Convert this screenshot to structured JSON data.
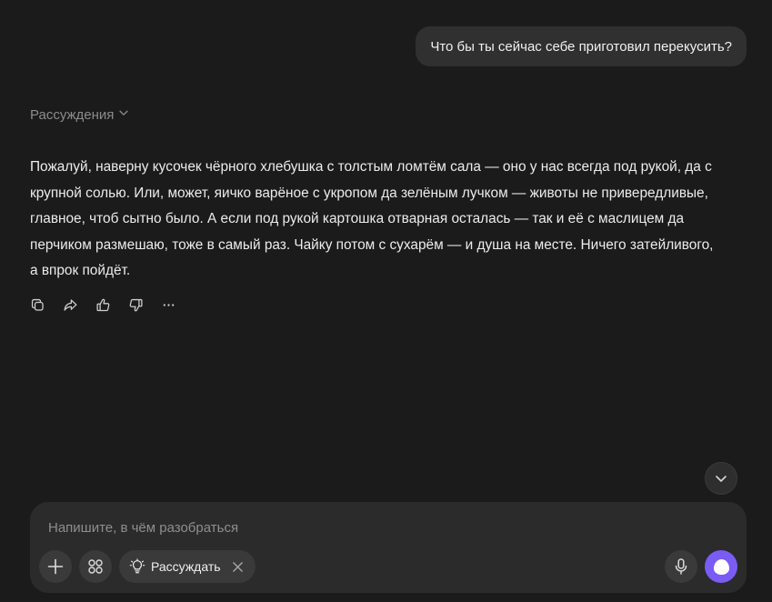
{
  "user_message": "Что бы ты сейчас себе приготовил перекусить?",
  "reasoning": {
    "label": "Рассуждения"
  },
  "answer": {
    "text": "Пожалуй, наверну кусочек чёрного хлебушка с толстым ломтём сала — оно у нас всегда под рукой, да с крупной солью. Или, может, яичко варёное с укропом да зелёным лучком — животы не привередливые, главное, чтоб сытно было. А если под рукой картошка отварная осталась — так и её с маслицем да перчиком размешаю, тоже в самый раз. Чайку потом с сухарём — и душа на месте. Ничего затейливого, а впрок пойдёт.",
    "actions": [
      {
        "icon": "copy-icon"
      },
      {
        "icon": "share-icon"
      },
      {
        "icon": "thumbs-up-icon"
      },
      {
        "icon": "thumbs-down-icon"
      },
      {
        "icon": "more-icon"
      }
    ]
  },
  "composer": {
    "placeholder": "Напишите, в чём разобраться",
    "value": "",
    "reason_chip_label": "Рассуждать",
    "icons": {
      "add": "plus-icon",
      "tools": "grid-icon",
      "reason": "lightbulb-icon",
      "remove": "close-icon",
      "mic": "microphone-icon",
      "send": "send-icon",
      "scroll": "chevron-down-icon"
    }
  },
  "colors": {
    "background": "#1b1b1b",
    "bubble": "#303030",
    "composer": "#2b2b2b",
    "accent": "#7a5cf5"
  }
}
